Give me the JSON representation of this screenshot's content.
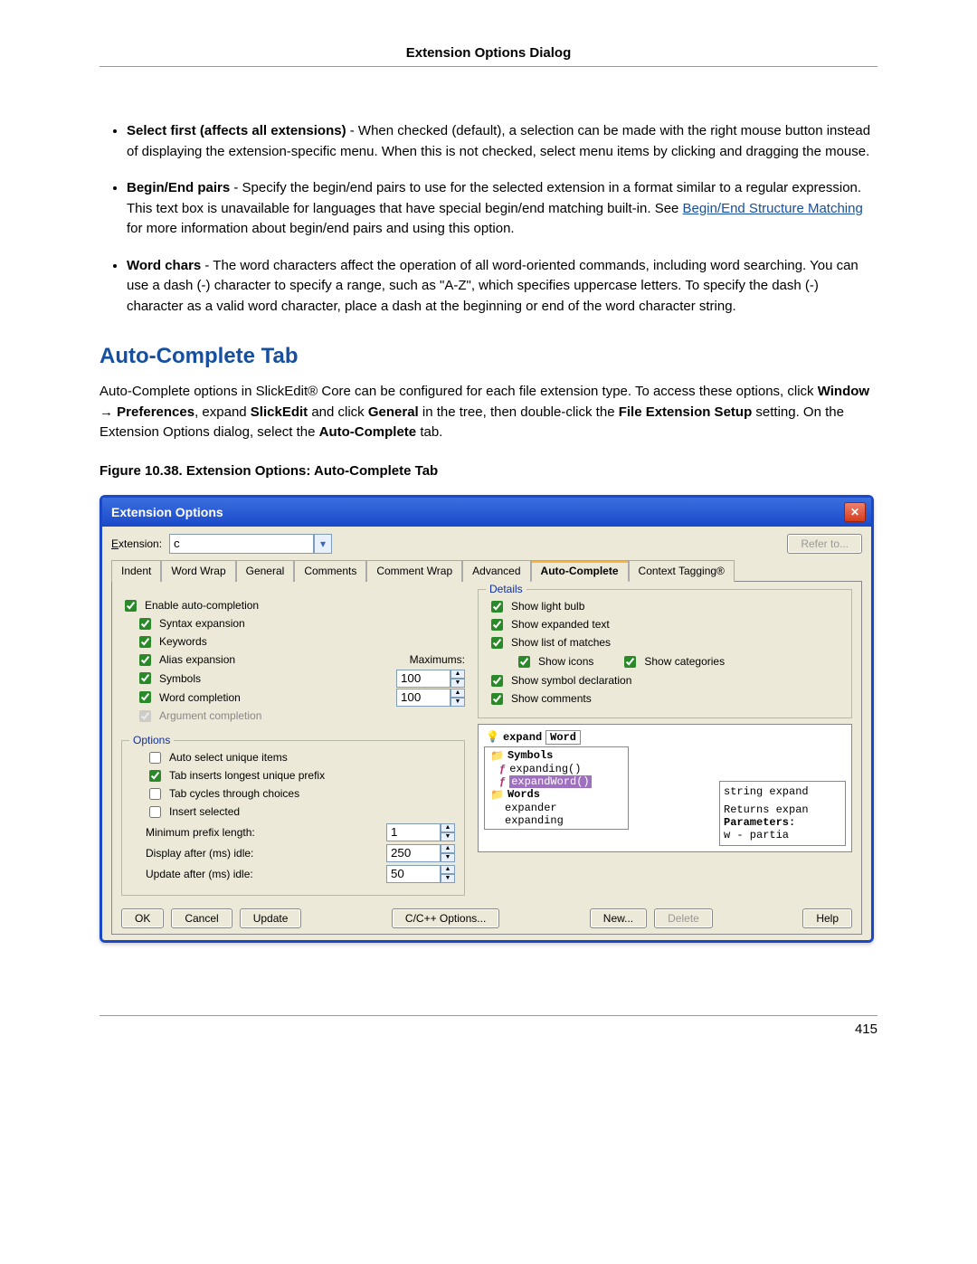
{
  "header": "Extension Options Dialog",
  "page_number": "415",
  "bullets": [
    {
      "term": "Select first (affects all extensions)",
      "text": " - When checked (default), a selection can be made with the right mouse button instead of displaying the extension-specific menu. When this is not checked, select menu items by clicking and dragging the mouse."
    },
    {
      "term": "Begin/End pairs",
      "text_before": " - Specify the begin/end pairs to use for the selected extension in a format similar to a regular expression. This text box is unavailable for languages that have special begin/end matching built-in. See ",
      "link": "Begin/End Structure Matching",
      "text_after": " for more information about begin/end pairs and using this option."
    },
    {
      "term": "Word chars",
      "text": " - The word characters affect the operation of all word-oriented commands, including word searching. You can use a dash (-) character to specify a range, such as \"A-Z\", which specifies uppercase letters. To specify the dash (-) character as a valid word character, place a dash at the beginning or end of the word character string."
    }
  ],
  "section_title": "Auto-Complete Tab",
  "intro_parts": {
    "p1a": "Auto-Complete options in SlickEdit",
    "p1b": " Core can be configured for each file extension type. To access these options, click ",
    "p_window": "Window",
    "arrow": " → ",
    "p_prefs": "Preferences",
    "p2": ", expand ",
    "p_slick": "SlickEdit",
    "p3": " and click ",
    "p_general": "General",
    "p4": " in the tree, then double-click the ",
    "p_fes": "File Extension Setup",
    "p5": " setting. On the Extension Options dialog, select the ",
    "p_ac": "Auto-Complete",
    "p6": " tab."
  },
  "figure_caption": "Figure 10.38. Extension Options: Auto-Complete Tab",
  "dialog": {
    "title": "Extension Options",
    "extension_label": "Extension:",
    "extension_value": "c",
    "refer_to": "Refer to...",
    "tabs": [
      "Indent",
      "Word Wrap",
      "General",
      "Comments",
      "Comment Wrap",
      "Advanced",
      "Auto-Complete",
      "Context Tagging®"
    ],
    "active_tab": 6,
    "left": {
      "enable": "Enable auto-completion",
      "syntax": "Syntax expansion",
      "keywords": "Keywords",
      "alias": "Alias expansion",
      "max_label": "Maximums:",
      "symbols": "Symbols",
      "symbols_max": "100",
      "word": "Word completion",
      "word_max": "100",
      "arg": "Argument completion"
    },
    "options": {
      "legend": "Options",
      "auto_select": "Auto select unique items",
      "tab_inserts": "Tab inserts longest unique prefix",
      "tab_cycles": "Tab cycles through choices",
      "insert_selected": "Insert selected",
      "min_prefix_label": "Minimum prefix length:",
      "min_prefix": "1",
      "display_after_label": "Display after (ms) idle:",
      "display_after": "250",
      "update_after_label": "Update after (ms) idle:",
      "update_after": "50"
    },
    "details": {
      "legend": "Details",
      "light_bulb": "Show light bulb",
      "expanded_text": "Show expanded text",
      "list_matches": "Show list of matches",
      "show_icons": "Show icons",
      "show_categories": "Show categories",
      "symbol_decl": "Show symbol declaration",
      "comments": "Show comments"
    },
    "preview": {
      "header_expand": "expand",
      "header_word": "Word",
      "symbols_folder": "Symbols",
      "expanding_fn": "expanding()",
      "expandWord_fn": "expandWord()",
      "words_folder": "Words",
      "expander": "expander",
      "expanding": "expanding",
      "side1": "string expand",
      "side2": "Returns expan",
      "side3": "Parameters:",
      "side4": "  w - partia"
    },
    "buttons": {
      "ok": "OK",
      "cancel": "Cancel",
      "update": "Update",
      "lang_options": "C/C++ Options...",
      "new_btn": "New...",
      "delete_btn": "Delete",
      "help": "Help"
    }
  }
}
